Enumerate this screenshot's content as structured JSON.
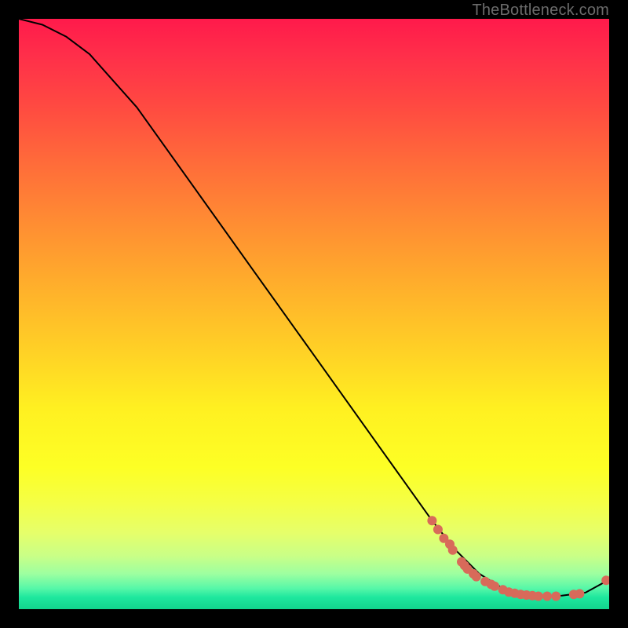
{
  "attribution": "TheBottleneck.com",
  "chart_data": {
    "type": "line",
    "title": "",
    "xlabel": "",
    "ylabel": "",
    "xlim": [
      0,
      100
    ],
    "ylim": [
      0,
      100
    ],
    "grid": false,
    "series": [
      {
        "name": "bottleneck-curve",
        "x": [
          0,
          4,
          8,
          12,
          20,
          30,
          40,
          50,
          60,
          70,
          74,
          78,
          82,
          85,
          88,
          92,
          96,
          100
        ],
        "y_percent_from_top": [
          0,
          1,
          3,
          6,
          15,
          29,
          43,
          57,
          71,
          85,
          90,
          94,
          96.5,
          97.5,
          97.8,
          97.7,
          97.2,
          95
        ],
        "color": "#000000"
      }
    ],
    "highlight_cluster": {
      "name": "marked-points",
      "color": "#d86a5a",
      "radius_px": 6,
      "points_xy_percent": [
        [
          70,
          85
        ],
        [
          71,
          86.5
        ],
        [
          72,
          88
        ],
        [
          73,
          89
        ],
        [
          73.5,
          90
        ],
        [
          75,
          92
        ],
        [
          75.5,
          92.6
        ],
        [
          76,
          93.2
        ],
        [
          77,
          94
        ],
        [
          77.5,
          94.5
        ],
        [
          79,
          95.3
        ],
        [
          80,
          95.8
        ],
        [
          80.6,
          96.1
        ],
        [
          82,
          96.7
        ],
        [
          83,
          97.1
        ],
        [
          84,
          97.3
        ],
        [
          85,
          97.5
        ],
        [
          86,
          97.6
        ],
        [
          87,
          97.7
        ],
        [
          88,
          97.8
        ],
        [
          89.5,
          97.8
        ],
        [
          91,
          97.8
        ],
        [
          94,
          97.5
        ],
        [
          95,
          97.4
        ],
        [
          99.5,
          95.1
        ]
      ]
    },
    "background_gradient_stops": [
      {
        "pos": 0.0,
        "color": "#ff1a4b"
      },
      {
        "pos": 0.25,
        "color": "#ff6a3a"
      },
      {
        "pos": 0.5,
        "color": "#ffc627"
      },
      {
        "pos": 0.75,
        "color": "#fdff25"
      },
      {
        "pos": 0.95,
        "color": "#9dffa0"
      },
      {
        "pos": 1.0,
        "color": "#12d48d"
      }
    ]
  }
}
